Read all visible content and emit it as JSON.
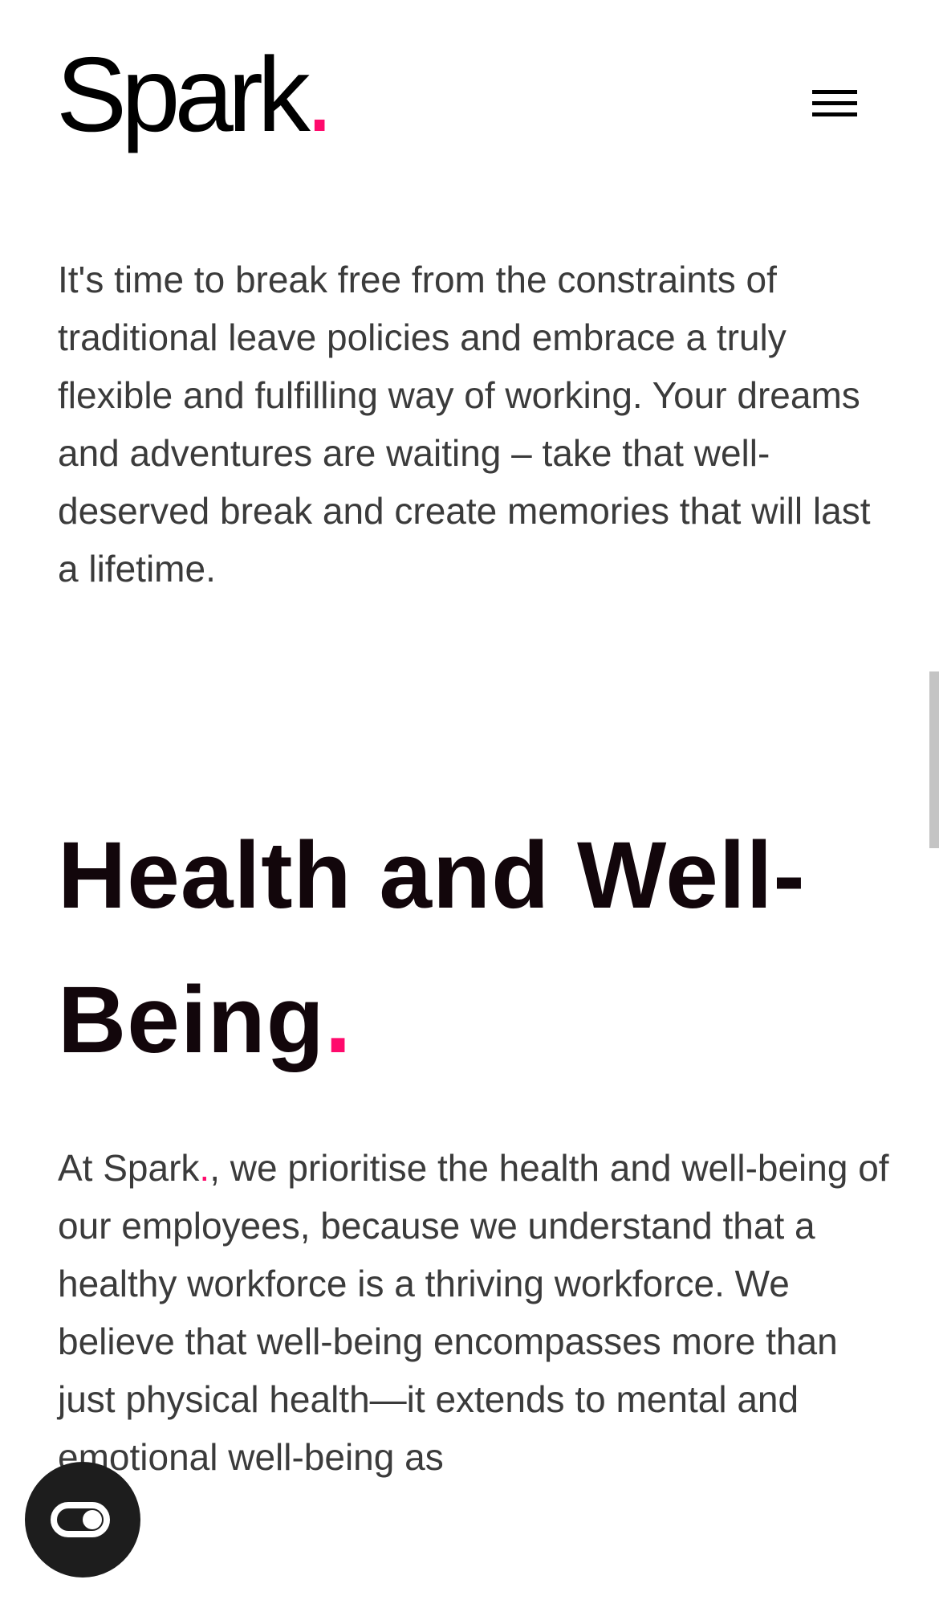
{
  "header": {
    "logo_text": "Spark",
    "logo_dot": ".",
    "menu_icon": "hamburger-menu-icon"
  },
  "main": {
    "intro_paragraph": "It's time to break free from the constraints of traditional leave policies and embrace a truly flexible and fulfilling way of working. Your dreams and adventures are waiting – take that well-deserved break and create memories that will last a lifetime.",
    "section": {
      "title": "Health and Well-Being",
      "title_dot": ".",
      "paragraph_prefix": "At Spark",
      "paragraph_dot": ".",
      "paragraph_rest": ", we prioritise the health and well-being of our employees, because we understand that a healthy workforce is a thriving workforce. We believe that well-being encompasses more than just physical health—it extends to mental and emotional well-being as"
    }
  },
  "widget": {
    "icon": "toggle-icon"
  },
  "colors": {
    "accent": "#ff0a6c",
    "heading": "#12060b",
    "body_text": "#3b3b3b",
    "fab_background": "#1d1d1d"
  }
}
